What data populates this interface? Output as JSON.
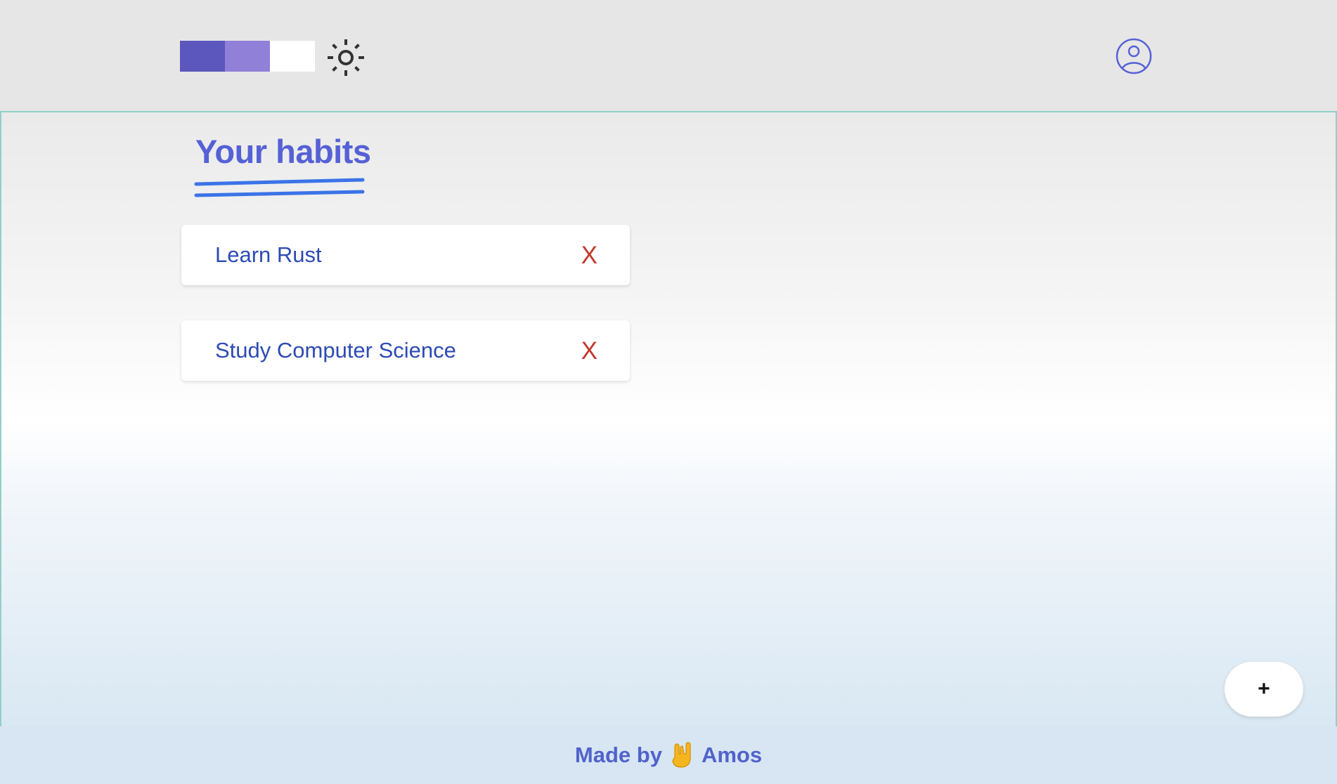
{
  "header": {
    "palette": {
      "colors": [
        "#5b57bd",
        "#9080d8",
        "#ffffff"
      ]
    },
    "theme_toggle_icon": "sun-icon",
    "profile_icon": "user-circle-icon"
  },
  "main": {
    "title": "Your habits",
    "habits": [
      {
        "name": "Learn Rust",
        "delete_label": "X"
      },
      {
        "name": "Study Computer Science",
        "delete_label": "X"
      }
    ],
    "add_button_label": "+"
  },
  "footer": {
    "made_by": "Made by",
    "emoji": "🤟",
    "author": "Amos"
  },
  "colors": {
    "accent": "#5561d6",
    "habit_text": "#2d4bb3",
    "delete": "#c0392b",
    "border": "#92cfca",
    "underline": "#3b73e8"
  }
}
